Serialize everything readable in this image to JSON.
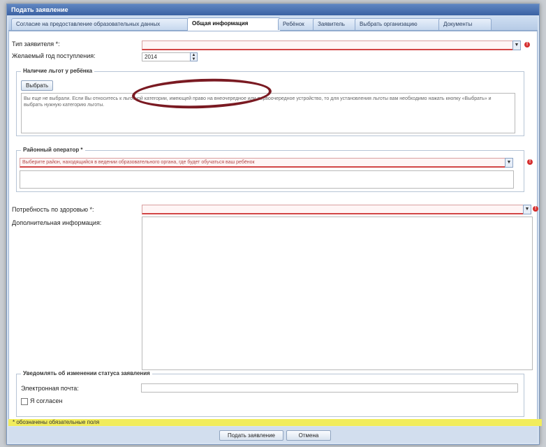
{
  "window": {
    "title": "Подать заявление"
  },
  "tabs": [
    {
      "label": "Согласие на предоставление образовательных данных"
    },
    {
      "label": "Общая информация"
    },
    {
      "label": "Ребёнок"
    },
    {
      "label": "Заявитель"
    },
    {
      "label": "Выбрать организацию"
    },
    {
      "label": "Документы"
    }
  ],
  "form": {
    "applicant_type_label": "Тип заявителя *:",
    "desired_year_label": "Желаемый год поступления:",
    "desired_year_value": "2014",
    "benefits_legend": "Наличие льгот у ребёнка",
    "benefits_add_button": "Выбрать",
    "benefits_note": "Вы еще не выбрали. Если Вы относитесь к льготной категории, имеющей право на внеочередное или первоочередное устройство, то для установления льготы вам необходимо нажать кнопку «Выбрать» и выбрать нужную категорию льготы.",
    "municipality_legend": "Районный оператор *",
    "municipality_placeholder": "Выберите район, находящийся в ведении образовательного органа, где будет обучаться ваш ребёнок",
    "health_needs_label": "Потребность по здоровью *:",
    "additional_info_label": "Дополнительная информация:",
    "notify_legend": "Уведомлять об изменении статуса заявления",
    "email_label": "Электронная почта:",
    "agree_label": "Я согласен"
  },
  "required_note": "* обозначены обязательные поля",
  "buttons": {
    "submit": "Подать заявление",
    "cancel": "Отмена"
  },
  "colors": {
    "titlebar": "#3b62a3",
    "error_underline": "#d24545",
    "required_bar": "#f1ec5c",
    "annotation_ellipse": "#7a1a22"
  }
}
